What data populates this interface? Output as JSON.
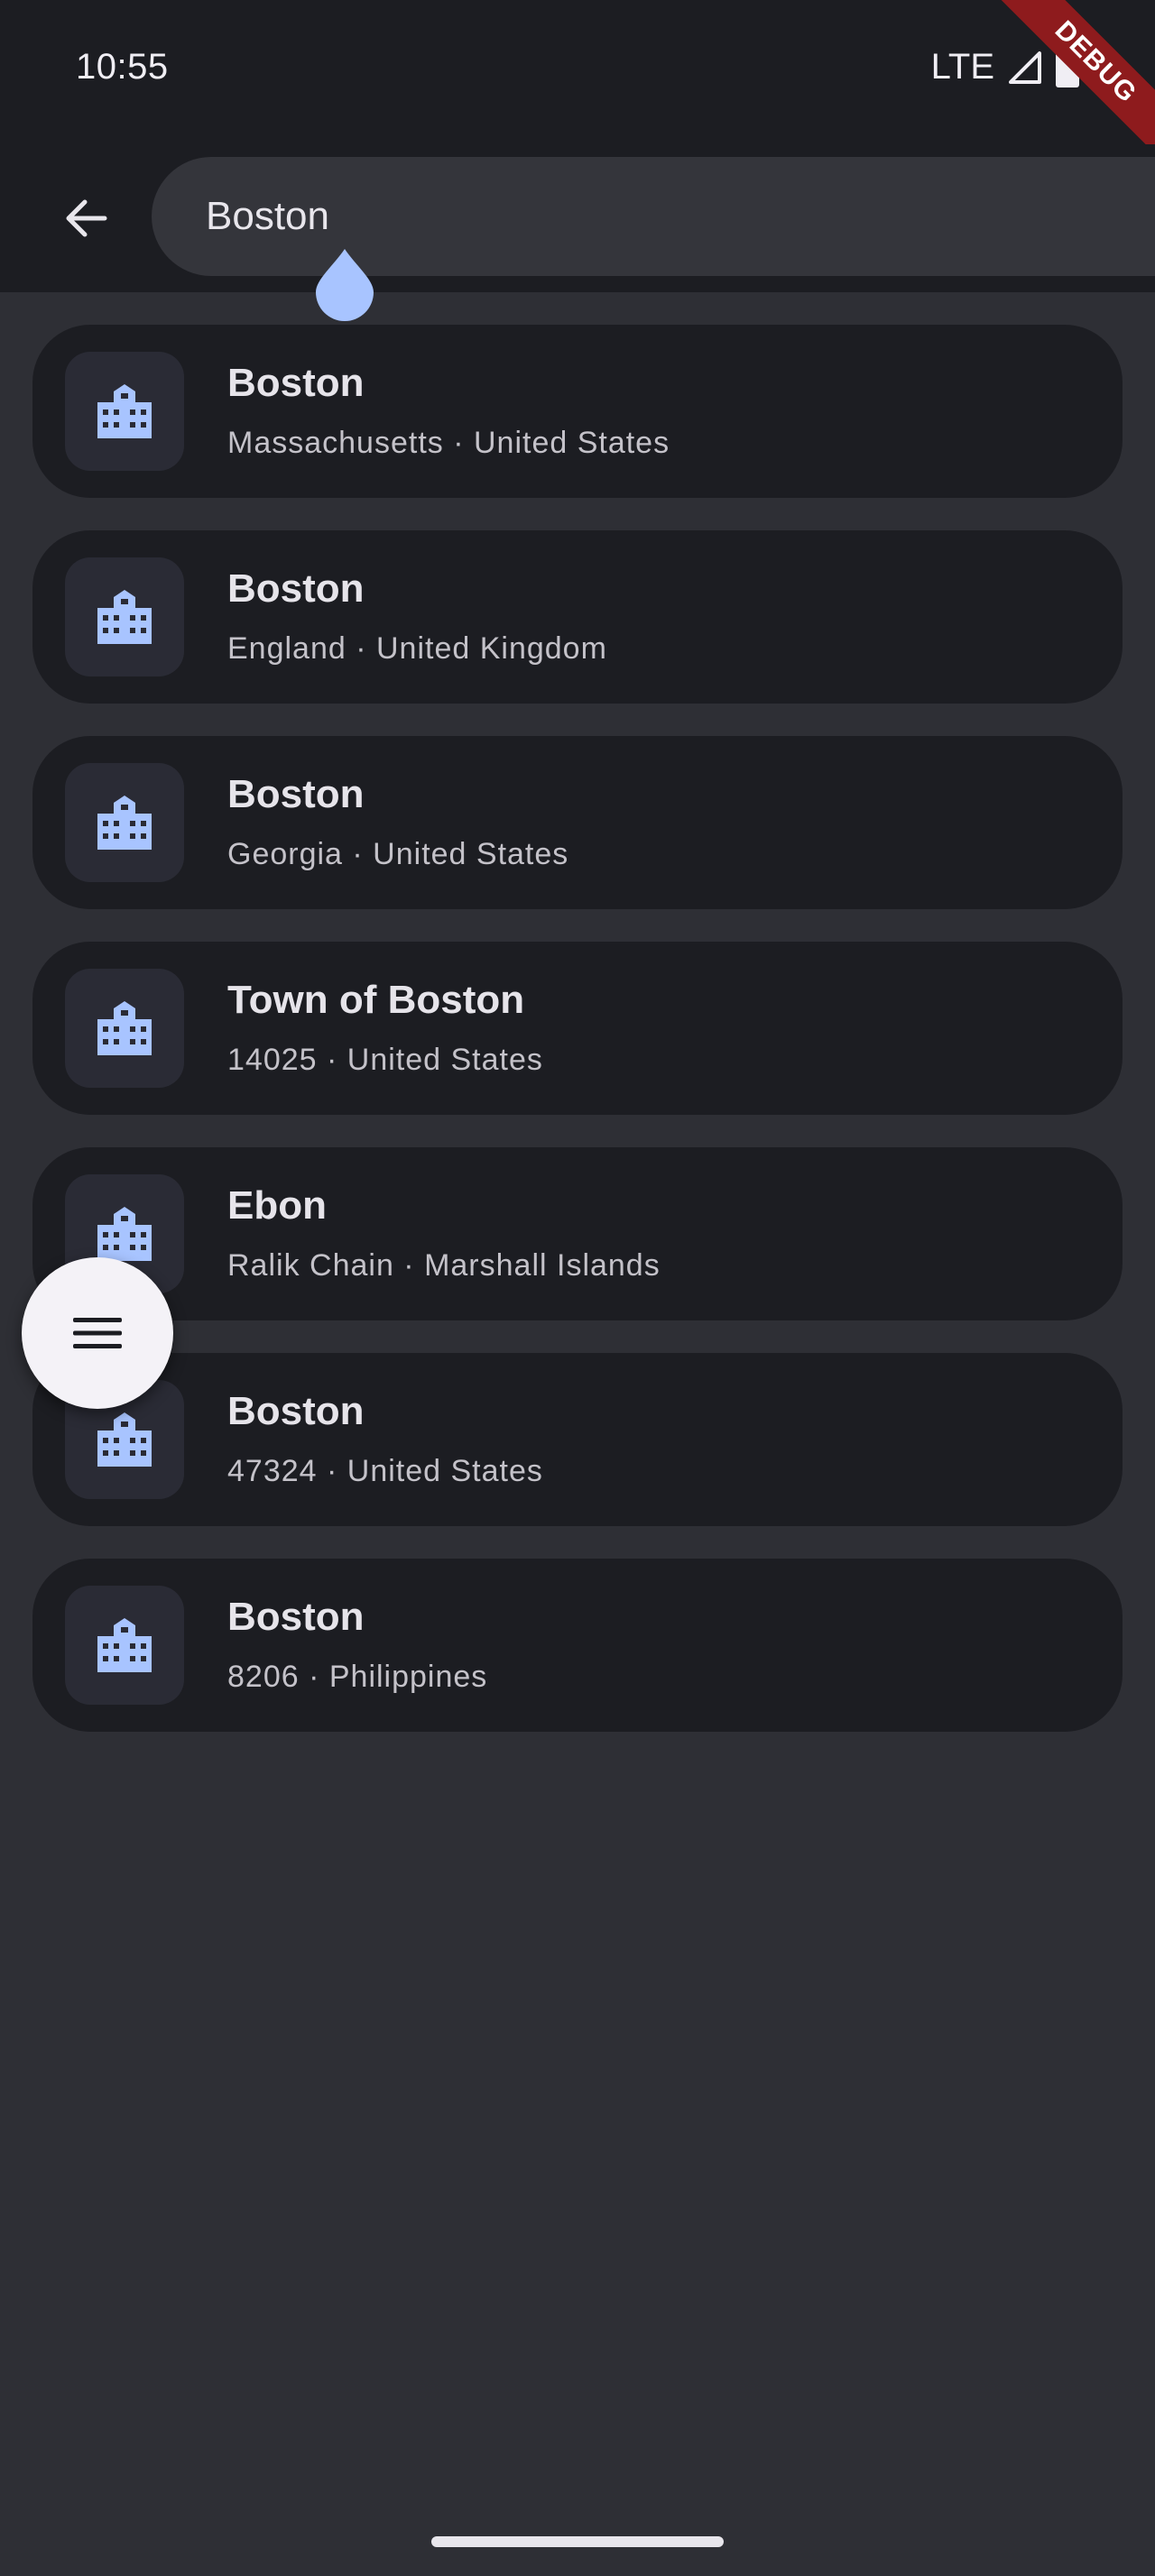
{
  "status_bar": {
    "time": "10:55",
    "network_label": "LTE",
    "signal_icon": "signal-triangle-icon",
    "battery_icon": "battery-icon"
  },
  "debug_banner": {
    "label": "DEBUG",
    "color": "#8e1b1d"
  },
  "search": {
    "back_icon": "arrow-back-icon",
    "query": "Boston",
    "placeholder": "",
    "caret_handle_color": "#a8c4ff"
  },
  "results": [
    {
      "title": "Boston",
      "subtitle": "Massachusetts · United States",
      "icon": "city-icon"
    },
    {
      "title": "Boston",
      "subtitle": "England · United Kingdom",
      "icon": "city-icon"
    },
    {
      "title": "Boston",
      "subtitle": "Georgia · United States",
      "icon": "city-icon"
    },
    {
      "title": "Town of Boston",
      "subtitle": "14025 · United States",
      "icon": "city-icon"
    },
    {
      "title": "Ebon",
      "subtitle": "Ralik Chain · Marshall Islands",
      "icon": "city-icon"
    },
    {
      "title": "Boston",
      "subtitle": "47324 · United States",
      "icon": "city-icon"
    },
    {
      "title": "Boston",
      "subtitle": "8206 · Philippines",
      "icon": "city-icon"
    }
  ],
  "fab": {
    "icon": "menu-icon"
  },
  "colors": {
    "background": "#2e2f35",
    "surface": "#1c1d22",
    "accent": "#a8c4ff"
  }
}
